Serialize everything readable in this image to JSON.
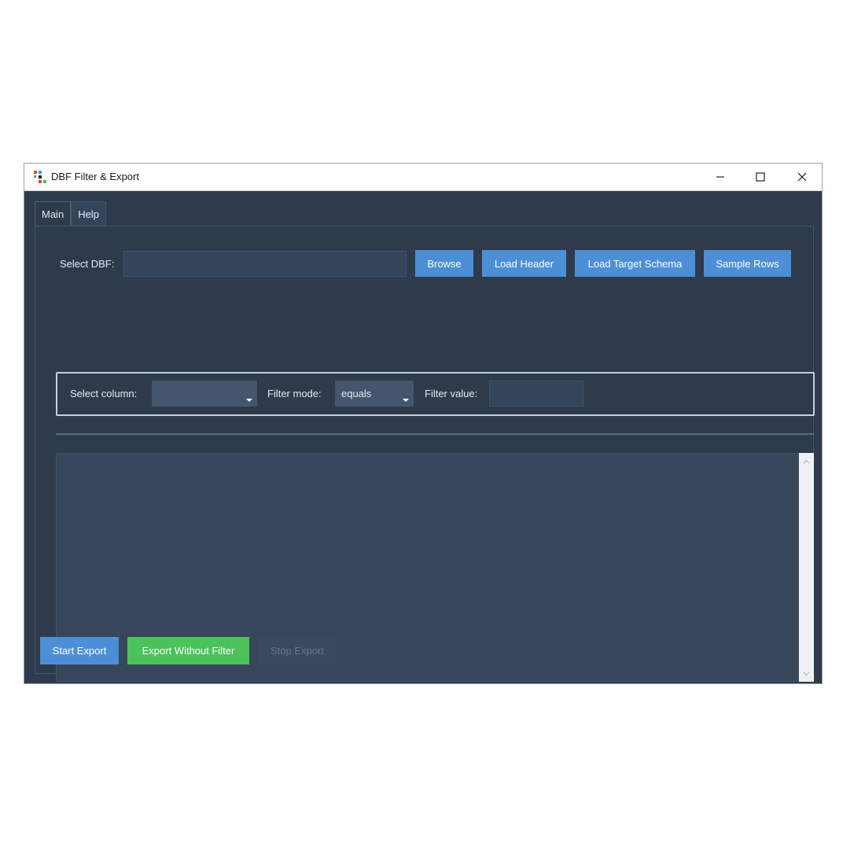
{
  "window": {
    "title": "DBF Filter & Export"
  },
  "tabs": [
    {
      "label": "Main"
    },
    {
      "label": "Help"
    }
  ],
  "file_row": {
    "select_label": "Select DBF:",
    "path_value": "",
    "browse_label": "Browse",
    "load_header_label": "Load Header",
    "load_target_schema_label": "Load Target Schema",
    "sample_rows_label": "Sample Rows"
  },
  "filter": {
    "column_label": "Select column:",
    "column_value": "",
    "mode_label": "Filter mode:",
    "mode_value": "equals",
    "value_label": "Filter value:",
    "value_value": ""
  },
  "log": {
    "text": ""
  },
  "actions": {
    "start_label": "Start Export",
    "without_filter_label": "Export Without Filter",
    "stop_label": "Stop Export"
  },
  "colors": {
    "background": "#2d3b4d",
    "accent_blue": "#4c8fd6",
    "accent_green": "#4cc25a"
  },
  "icons": {
    "app": "app-icon",
    "minimize": "minimize-icon",
    "maximize": "maximize-icon",
    "close": "close-icon"
  }
}
